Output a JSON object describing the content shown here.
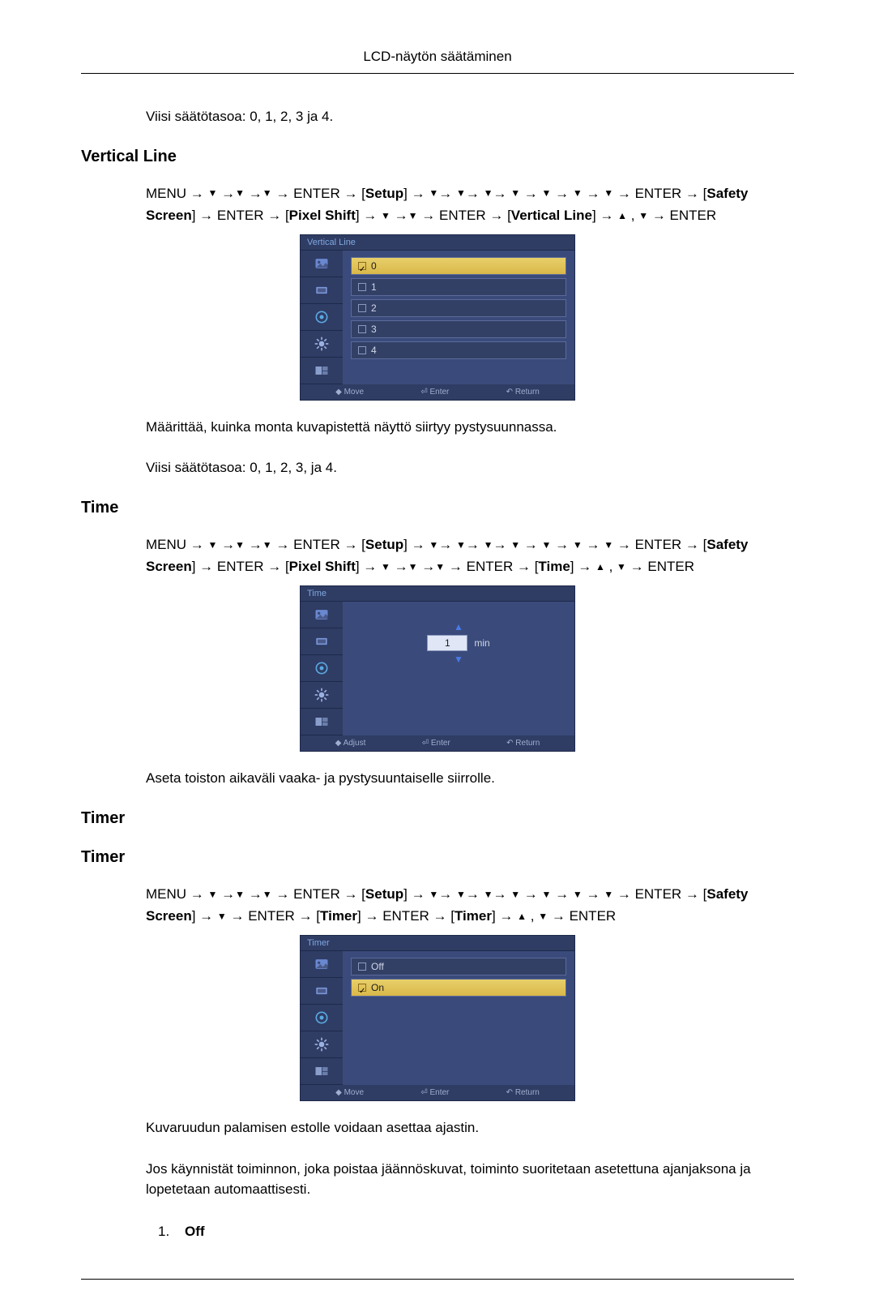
{
  "header": "LCD-näytön säätäminen",
  "sec1": {
    "line1": "Viisi säätötasoa: 0, 1, 2, 3 ja 4."
  },
  "vl": {
    "heading": "Vertical Line",
    "nav_p1a": "MENU",
    "nav_p1b": "ENTER",
    "nav_p1c": "Setup",
    "nav_p1d": "ENTER",
    "nav_p1e": "Safety Screen",
    "nav_p2a": "ENTER",
    "nav_p2b": "Pixel Shift",
    "nav_p2c": "ENTER",
    "nav_p2d": "Vertical Line",
    "nav_p2e": "ENTER",
    "osd_title": "Vertical Line",
    "opts": [
      "0",
      "1",
      "2",
      "3",
      "4"
    ],
    "foot_move": "Move",
    "foot_enter": "Enter",
    "foot_return": "Return",
    "desc1": "Määrittää, kuinka monta kuvapistettä näyttö siirtyy pystysuunnassa.",
    "desc2": "Viisi säätötasoa: 0, 1, 2, 3, ja 4."
  },
  "time": {
    "heading": "Time",
    "nav_p1a": "MENU",
    "nav_p1b": "ENTER",
    "nav_p1c": "Setup",
    "nav_p1d": "ENTER",
    "nav_p1e": "Safety Screen",
    "nav_p2a": "ENTER",
    "nav_p2b": "Pixel Shift",
    "nav_p2c": "ENTER",
    "nav_p2d": "Time",
    "nav_p2e": "ENTER",
    "osd_title": "Time",
    "spin_val": "1",
    "spin_unit": "min",
    "foot_adjust": "Adjust",
    "foot_enter": "Enter",
    "foot_return": "Return",
    "desc1": "Aseta toiston aikaväli vaaka- ja pystysuuntaiselle siirrolle."
  },
  "timer": {
    "heading1": "Timer",
    "heading2": "Timer",
    "nav_p1a": "MENU",
    "nav_p1b": "ENTER",
    "nav_p1c": "Setup",
    "nav_p1d": "ENTER",
    "nav_p1e": "Safety Screen",
    "nav_p2a": "ENTER",
    "nav_p2b": "Timer",
    "nav_p2c": "ENTER",
    "nav_p2d": "Timer",
    "nav_p2e": "ENTER",
    "osd_title": "Timer",
    "opt_off": "Off",
    "opt_on": "On",
    "foot_move": "Move",
    "foot_enter": "Enter",
    "foot_return": "Return",
    "desc1": "Kuvaruudun palamisen estolle voidaan asettaa ajastin.",
    "desc2": "Jos käynnistät toiminnon, joka poistaa jäännöskuvat, toiminto suoritetaan asetettuna ajanjaksona ja lopetetaan automaattisesti.",
    "li1_num": "1.",
    "li1_label": "Off"
  },
  "icons": {
    "picture": "picture-icon",
    "input": "input-icon",
    "sound": "sound-icon",
    "setup": "setup-icon",
    "multi": "multi-icon"
  }
}
